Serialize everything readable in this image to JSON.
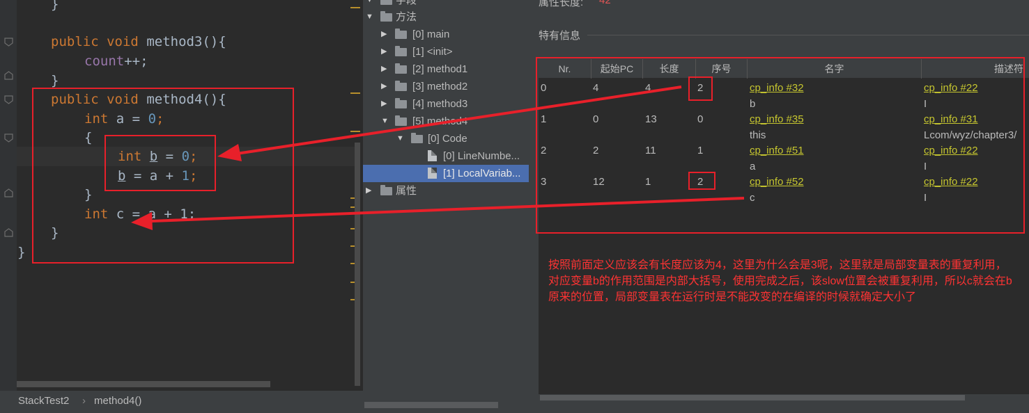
{
  "editor": {
    "lines": {
      "close_brace_top": "}",
      "m3_public": "public",
      "m3_void": "void",
      "m3_name": "method3",
      "m3_paren": "(){",
      "count": "count",
      "count_op": "++;",
      "close_m3": "}",
      "m4_public": "public",
      "m4_void": "void",
      "m4_name": "method4",
      "m4_paren": "(){",
      "a_int": "int",
      "a_name": "a",
      "a_eq": " = ",
      "a_val": "0",
      "a_semi": ";",
      "open_block": "{",
      "b_int": "int",
      "b_name": "b",
      "b_eq": " = ",
      "b_val": "0",
      "b_semi": ";",
      "b2_name": "b",
      "b2_expr": " = a + ",
      "b2_val": "1",
      "b2_semi": ";",
      "close_block": "}",
      "c_int": "int",
      "c_name": "c",
      "c_expr": " = a + 1;",
      "close_m4": "}",
      "close_class": "}"
    }
  },
  "breadcrumb": {
    "class_name": "StackTest2",
    "separator": "›",
    "method_name": "method4()"
  },
  "tree": {
    "fields_label": "字段",
    "methods_label": "方法",
    "items": [
      {
        "label": "[0] main"
      },
      {
        "label": "[1] <init>"
      },
      {
        "label": "[2] method1"
      },
      {
        "label": "[3] method2"
      },
      {
        "label": "[4] method3"
      },
      {
        "label": "[5] method4"
      },
      {
        "label": "[0] Code"
      },
      {
        "label": "[0] LineNumbe..."
      },
      {
        "label": "[1] LocalVariab..."
      }
    ],
    "attributes_label": "属性"
  },
  "right": {
    "attr_length_label": "属性长度:",
    "attr_length_value": "42",
    "section_label": "特有信息",
    "columns": [
      "Nr.",
      "起始PC",
      "长度",
      "序号",
      "名字",
      "描述符"
    ],
    "rows": [
      {
        "nr": "0",
        "start_pc": "4",
        "length": "4",
        "index": "2",
        "name_ref": "cp_info #32",
        "name": "b",
        "desc_ref": "cp_info #22",
        "desc": "I"
      },
      {
        "nr": "1",
        "start_pc": "0",
        "length": "13",
        "index": "0",
        "name_ref": "cp_info #35",
        "name": "this",
        "desc_ref": "cp_info #31",
        "desc": "Lcom/wyz/chapter3/"
      },
      {
        "nr": "2",
        "start_pc": "2",
        "length": "11",
        "index": "1",
        "name_ref": "cp_info #51",
        "name": "a",
        "desc_ref": "cp_info #22",
        "desc": "I"
      },
      {
        "nr": "3",
        "start_pc": "12",
        "length": "1",
        "index": "2",
        "name_ref": "cp_info #52",
        "name": "c",
        "desc_ref": "cp_info #22",
        "desc": "I"
      }
    ],
    "note": "按照前面定义应该会有长度应该为4，这里为什么会是3呢，这里就是局部变量表的重复利用，对应变量b的作用范围是内部大括号，使用完成之后，该slow位置会被重复利用，所以c就会在b原来的位置，局部变量表在运行时是不能改变的在编译的时候就确定大小了"
  },
  "colors": {
    "annotation": "#e8202a",
    "link": "#c6c62f",
    "keyword": "#cc7832",
    "number": "#6897bb",
    "field": "#9876aa",
    "selection": "#4b6eaf"
  }
}
